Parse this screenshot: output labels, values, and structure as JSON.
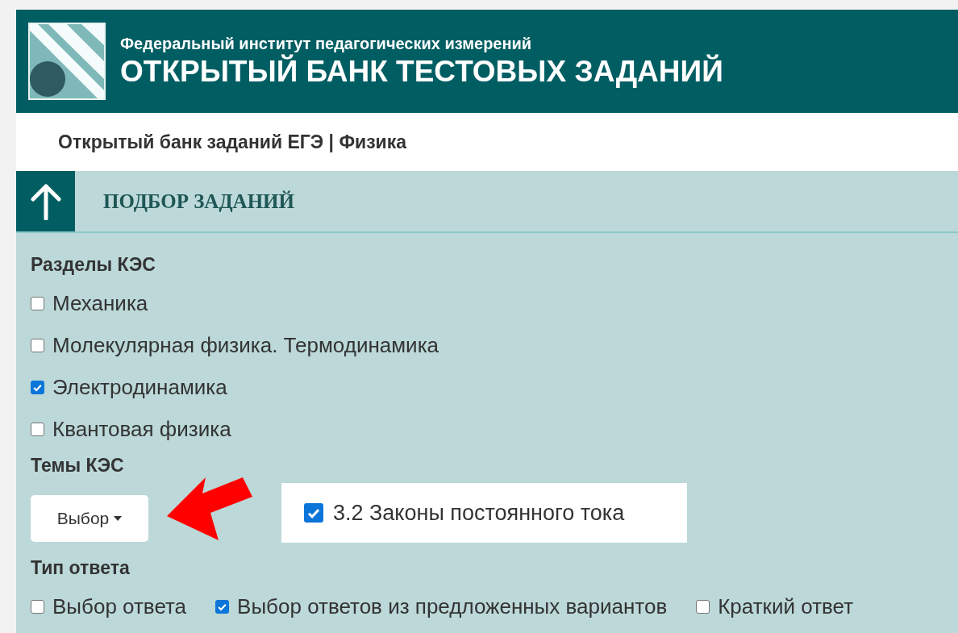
{
  "header": {
    "subtitle": "Федеральный институт педагогических измерений",
    "title": "ОТКРЫТЫЙ БАНК ТЕСТОВЫХ ЗАДАНИЙ"
  },
  "breadcrumb": "Открытый банк заданий ЕГЭ | Физика",
  "section": {
    "title": "ПОДБОР ЗАДАНИЙ"
  },
  "kes_sections": {
    "label": "Разделы КЭС",
    "items": [
      {
        "label": "Механика",
        "checked": false
      },
      {
        "label": "Молекулярная физика. Термодинамика",
        "checked": false
      },
      {
        "label": "Электродинамика",
        "checked": true
      },
      {
        "label": "Квантовая физика",
        "checked": false
      }
    ]
  },
  "kes_topics": {
    "label": "Темы КЭС",
    "dropdown": "Выбор",
    "selected_topics": [
      {
        "label": "3.2 Законы постоянного тока",
        "checked": true
      }
    ]
  },
  "answer_type": {
    "label": "Тип ответа",
    "items": [
      {
        "label": "Выбор ответа",
        "checked": false
      },
      {
        "label": "Выбор ответов из предложенных вариантов",
        "checked": true
      },
      {
        "label": "Краткий ответ",
        "checked": false
      }
    ]
  }
}
